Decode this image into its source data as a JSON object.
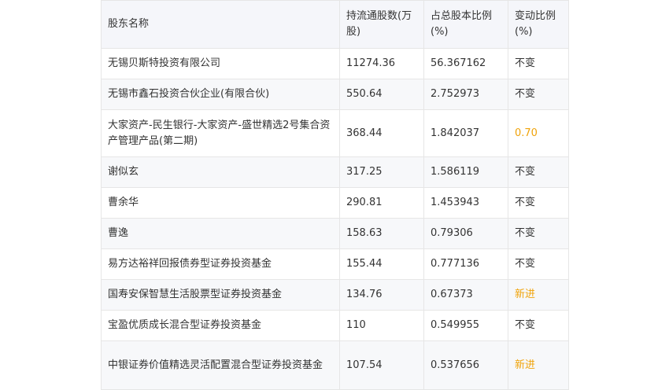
{
  "table": {
    "headers": [
      "股东名称",
      "持流通股数(万股)",
      "占总股本比例(%)",
      "变动比例(%)"
    ],
    "rows": [
      {
        "name": "无锡贝斯特投资有限公司",
        "shares": "11274.36",
        "ratio": "56.367162",
        "change": "不变"
      },
      {
        "name": "无锡市鑫石投资合伙企业(有限合伙)",
        "shares": "550.64",
        "ratio": "2.752973",
        "change": "不变"
      },
      {
        "name": "大家资产-民生银行-大家资产-盛世精选2号集合资产管理产品(第二期)",
        "shares": "368.44",
        "ratio": "1.842037",
        "change": "0.70"
      },
      {
        "name": "谢似玄",
        "shares": "317.25",
        "ratio": "1.586119",
        "change": "不变"
      },
      {
        "name": "曹余华",
        "shares": "290.81",
        "ratio": "1.453943",
        "change": "不变"
      },
      {
        "name": "曹逸",
        "shares": "158.63",
        "ratio": "0.79306",
        "change": "不变"
      },
      {
        "name": "易方达裕祥回报债券型证券投资基金",
        "shares": "155.44",
        "ratio": "0.777136",
        "change": "不变"
      },
      {
        "name": "国寿安保智慧生活股票型证券投资基金",
        "shares": "134.76",
        "ratio": "0.67373",
        "change": "新进"
      },
      {
        "name": "宝盈优质成长混合型证券投资基金",
        "shares": "110",
        "ratio": "0.549955",
        "change": "不变"
      },
      {
        "name": "中银证券价值精选灵活配置混合型证券投资基金",
        "shares": "107.54",
        "ratio": "0.537656",
        "change": "新进"
      }
    ]
  },
  "colors": {
    "accent_change": "#f0a30a",
    "text": "#333333",
    "header_bg": "#f5f6fa",
    "border": "#e6e6e6"
  }
}
